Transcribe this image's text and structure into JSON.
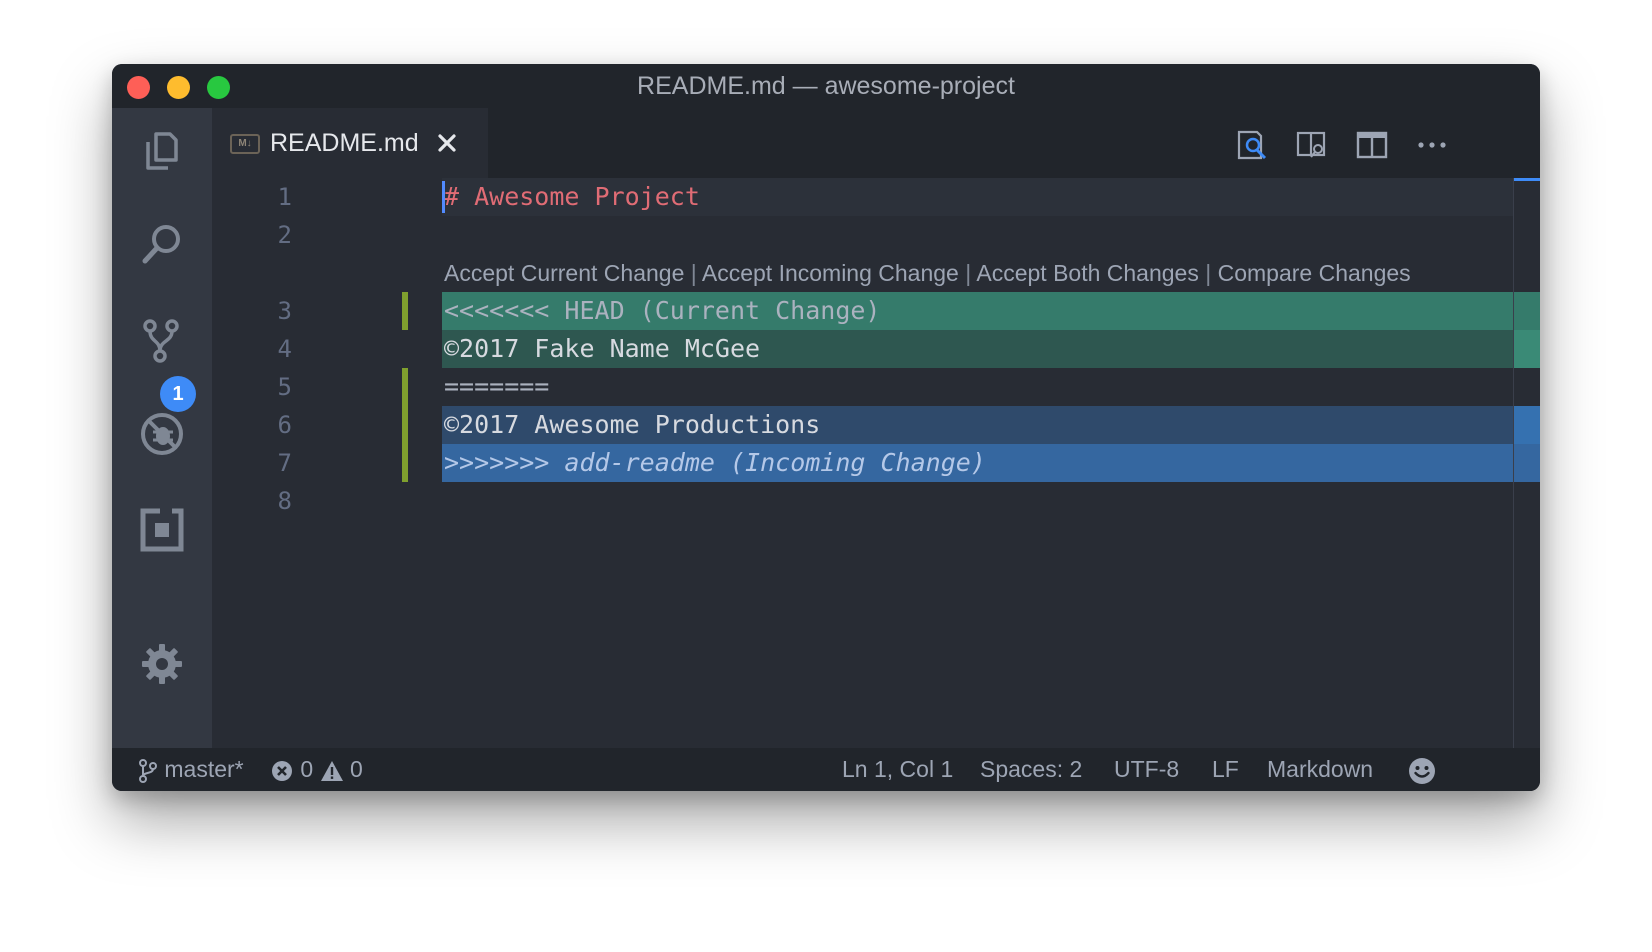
{
  "window": {
    "title": "README.md — awesome-project"
  },
  "activity_bar": {
    "items": [
      {
        "name": "explorer",
        "icon": "files-icon"
      },
      {
        "name": "search",
        "icon": "search-icon"
      },
      {
        "name": "source-control",
        "icon": "source-control-icon",
        "badge": "1"
      },
      {
        "name": "debug",
        "icon": "debug-icon"
      },
      {
        "name": "extensions",
        "icon": "extensions-icon"
      },
      {
        "name": "settings",
        "icon": "gear-icon"
      }
    ]
  },
  "tab": {
    "file_icon_text": "M↓",
    "label": "README.md",
    "close_icon": "close-icon"
  },
  "tab_actions": [
    "open-preview-icon",
    "open-preview-side-icon",
    "split-editor-icon",
    "more-icon"
  ],
  "editor": {
    "lines": [
      {
        "number": "1",
        "text": "# Awesome Project"
      },
      {
        "number": "2",
        "text": ""
      },
      {
        "number": "3",
        "text": "<<<<<<< HEAD (Current Change)"
      },
      {
        "number": "4",
        "text": "©2017 Fake Name McGee"
      },
      {
        "number": "5",
        "text": "======="
      },
      {
        "number": "6",
        "text": "©2017 Awesome Productions"
      },
      {
        "number": "7",
        "marker": ">>>>>>> ",
        "text": "add-readme (Incoming Change)"
      },
      {
        "number": "8",
        "text": ""
      }
    ],
    "codelens": {
      "accept_current": "Accept Current Change",
      "accept_incoming": "Accept Incoming Change",
      "accept_both": "Accept Both Changes",
      "compare": "Compare Changes",
      "separator": "|"
    }
  },
  "colors": {
    "current_header": "#357b6b",
    "current_content": "#2e5750",
    "incoming_content": "#2f4a6b",
    "incoming_header": "#3567a0",
    "heading": "#e06c75",
    "badge": "#3e8bf7"
  },
  "status_bar": {
    "branch": "master*",
    "errors": "0",
    "warnings": "0",
    "position": "Ln 1, Col 1",
    "indentation": "Spaces: 2",
    "encoding": "UTF-8",
    "eol": "LF",
    "language": "Markdown",
    "feedback_icon": "smiley-icon"
  }
}
